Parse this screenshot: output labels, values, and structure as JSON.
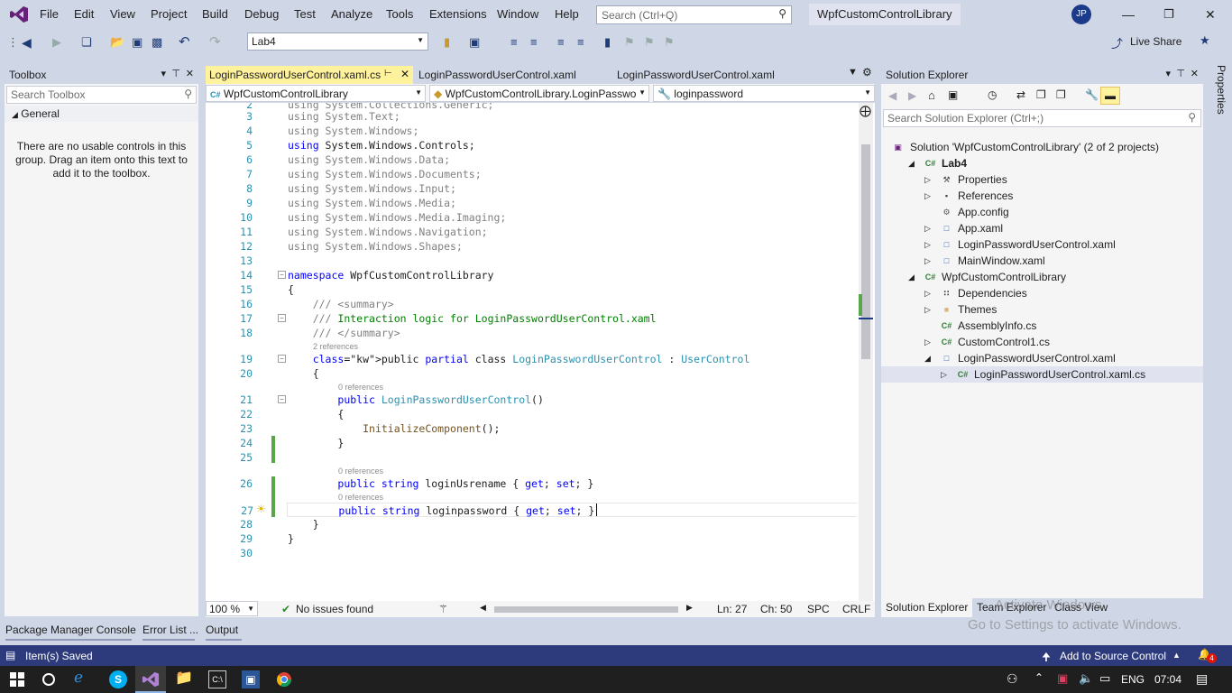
{
  "menu": [
    "File",
    "Edit",
    "View",
    "Project",
    "Build",
    "Debug",
    "Test",
    "Analyze",
    "Tools",
    "Extensions",
    "Window",
    "Help"
  ],
  "search": {
    "placeholder": "Search (Ctrl+Q)"
  },
  "solution_name": "WpfCustomControlLibrary",
  "avatar": "JP",
  "toolbar": {
    "config_combo": "Lab4",
    "live_share": "Live Share"
  },
  "toolbox": {
    "title": "Toolbox",
    "search_placeholder": "Search Toolbox",
    "group": "General",
    "empty_text": "There are no usable controls in this group. Drag an item onto this text to add it to the toolbox."
  },
  "editor": {
    "tabs": [
      "LoginPasswordUserControl.xaml.cs",
      "LoginPasswordUserControl.xaml",
      "LoginPasswordUserControl.xaml"
    ],
    "nav": [
      "WpfCustomControlLibrary",
      "WpfCustomControlLibrary.LoginPasswo",
      "loginpassword"
    ],
    "lines": [
      {
        "n": "2",
        "text": "using System.Collections.Generic;",
        "cls": "gray"
      },
      {
        "n": "3",
        "text": "using System.Text;",
        "cls": "gray"
      },
      {
        "n": "4",
        "text": "using System.Windows;",
        "cls": "gray"
      },
      {
        "n": "5",
        "text": "using System.Windows.Controls;",
        "cls": "used"
      },
      {
        "n": "6",
        "text": "using System.Windows.Data;",
        "cls": "gray"
      },
      {
        "n": "7",
        "text": "using System.Windows.Documents;",
        "cls": "gray"
      },
      {
        "n": "8",
        "text": "using System.Windows.Input;",
        "cls": "gray"
      },
      {
        "n": "9",
        "text": "using System.Windows.Media;",
        "cls": "gray"
      },
      {
        "n": "10",
        "text": "using System.Windows.Media.Imaging;",
        "cls": "gray"
      },
      {
        "n": "11",
        "text": "using System.Windows.Navigation;",
        "cls": "gray"
      },
      {
        "n": "12",
        "text": "using System.Windows.Shapes;",
        "cls": "gray"
      },
      {
        "n": "13",
        "text": "",
        "cls": ""
      },
      {
        "n": "14",
        "text": "namespace WpfCustomControlLibrary",
        "cls": "ns"
      },
      {
        "n": "15",
        "text": "{",
        "cls": ""
      },
      {
        "n": "16",
        "text": "    /// <summary>",
        "cls": "doc"
      },
      {
        "n": "17",
        "text": "    /// Interaction logic for LoginPasswordUserControl.xaml",
        "cls": "doc2"
      },
      {
        "n": "18",
        "text": "    /// </summary>",
        "cls": "doc"
      },
      {
        "n": "19",
        "text": "    public partial class LoginPasswordUserControl : UserControl",
        "cls": "cls"
      },
      {
        "n": "20",
        "text": "    {",
        "cls": ""
      },
      {
        "n": "21",
        "text": "        public LoginPasswordUserControl()",
        "cls": "ctor"
      },
      {
        "n": "22",
        "text": "        {",
        "cls": ""
      },
      {
        "n": "23",
        "text": "            InitializeComponent();",
        "cls": "call"
      },
      {
        "n": "24",
        "text": "        }",
        "cls": ""
      },
      {
        "n": "25",
        "text": "",
        "cls": ""
      },
      {
        "n": "26",
        "text": "        public string loginUsrename { get; set; }",
        "cls": "prop"
      },
      {
        "n": "27",
        "text": "        public string loginpassword { get; set; }",
        "cls": "prop"
      },
      {
        "n": "28",
        "text": "    }",
        "cls": ""
      },
      {
        "n": "29",
        "text": "}",
        "cls": ""
      },
      {
        "n": "30",
        "text": "",
        "cls": ""
      }
    ],
    "lens": {
      "l19": "2 references",
      "l21": "0 references",
      "l26": "0 references",
      "l27": "0 references"
    },
    "zoom": "100 %",
    "issues": "No issues found",
    "ln": "Ln: 27",
    "ch": "Ch: 50",
    "spc": "SPC",
    "crlf": "CRLF"
  },
  "solution_explorer": {
    "title": "Solution Explorer",
    "search_placeholder": "Search Solution Explorer (Ctrl+;)",
    "items": [
      {
        "label": "Solution 'WpfCustomControlLibrary' (2 of 2 projects)",
        "indent": 0,
        "arrow": "",
        "icon": "solution-icon",
        "bold": false,
        "sel": false
      },
      {
        "label": "Lab4",
        "indent": 1,
        "arrow": "◢",
        "icon": "csharp-project-icon",
        "bold": true,
        "sel": false
      },
      {
        "label": "Properties",
        "indent": 2,
        "arrow": "▷",
        "icon": "wrench-icon",
        "bold": false,
        "sel": false
      },
      {
        "label": "References",
        "indent": 2,
        "arrow": "▷",
        "icon": "references-icon",
        "bold": false,
        "sel": false
      },
      {
        "label": "App.config",
        "indent": 2,
        "arrow": "",
        "icon": "config-file-icon",
        "bold": false,
        "sel": false
      },
      {
        "label": "App.xaml",
        "indent": 2,
        "arrow": "▷",
        "icon": "xaml-file-icon",
        "bold": false,
        "sel": false
      },
      {
        "label": "LoginPasswordUserControl.xaml",
        "indent": 2,
        "arrow": "▷",
        "icon": "xaml-file-icon",
        "bold": false,
        "sel": false
      },
      {
        "label": "MainWindow.xaml",
        "indent": 2,
        "arrow": "▷",
        "icon": "xaml-file-icon",
        "bold": false,
        "sel": false
      },
      {
        "label": "WpfCustomControlLibrary",
        "indent": 1,
        "arrow": "◢",
        "icon": "csharp-project-icon",
        "bold": false,
        "sel": false
      },
      {
        "label": "Dependencies",
        "indent": 2,
        "arrow": "▷",
        "icon": "dependencies-icon",
        "bold": false,
        "sel": false
      },
      {
        "label": "Themes",
        "indent": 2,
        "arrow": "▷",
        "icon": "folder-icon",
        "bold": false,
        "sel": false
      },
      {
        "label": "AssemblyInfo.cs",
        "indent": 2,
        "arrow": "",
        "icon": "csharp-file-icon",
        "bold": false,
        "sel": false
      },
      {
        "label": "CustomControl1.cs",
        "indent": 2,
        "arrow": "▷",
        "icon": "csharp-file-icon",
        "bold": false,
        "sel": false
      },
      {
        "label": "LoginPasswordUserControl.xaml",
        "indent": 2,
        "arrow": "◢",
        "icon": "xaml-file-icon",
        "bold": false,
        "sel": false
      },
      {
        "label": "LoginPasswordUserControl.xaml.cs",
        "indent": 3,
        "arrow": "▷",
        "icon": "csharp-file-icon",
        "bold": false,
        "sel": true
      }
    ],
    "tabs": [
      "Solution Explorer",
      "Team Explorer",
      "Class View"
    ]
  },
  "properties_label": "Properties",
  "bottom_tabs": [
    "Package Manager Console",
    "Error List ...",
    "Output"
  ],
  "status": {
    "message": "Item(s) Saved",
    "source_control": "Add to Source Control",
    "notifications": "4"
  },
  "watermark": {
    "line1": "Activate Windows",
    "line2": "Go to Settings to activate Windows."
  },
  "taskbar": {
    "lang": "ENG",
    "time": "07:04"
  },
  "colors": {
    "accent": "#2d3b7c",
    "chrome": "#cfd6e5",
    "active_tab": "#fff29d",
    "keyword": "#0000ff",
    "type": "#2b91af",
    "comment": "#008000",
    "added_line": "#57a64a"
  }
}
